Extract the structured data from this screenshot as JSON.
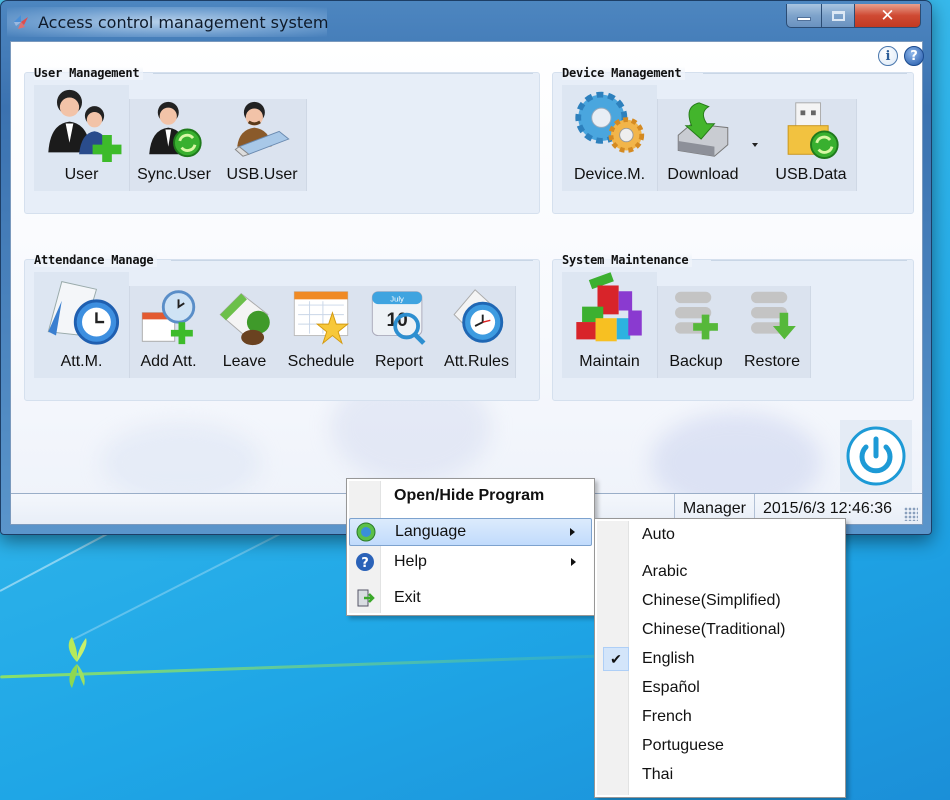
{
  "window": {
    "title": "Access control management system",
    "icon": "app-logo-icon",
    "caption_buttons": [
      "minimize",
      "maximize",
      "close"
    ],
    "close_glyph": "✕"
  },
  "top_icons": [
    {
      "name": "info-icon",
      "glyph": "i"
    },
    {
      "name": "help-icon",
      "glyph": "?"
    }
  ],
  "groups": {
    "user_management": {
      "title": "User Management",
      "primary": {
        "label": "User",
        "icon": "user-add-icon"
      },
      "items": [
        {
          "label": "Sync.User",
          "icon": "sync-user-icon"
        },
        {
          "label": "USB.User",
          "icon": "usb-user-icon"
        }
      ]
    },
    "device_management": {
      "title": "Device Management",
      "primary": {
        "label": "Device.M.",
        "icon": "gears-icon"
      },
      "items": [
        {
          "label": "Download",
          "icon": "download-disk-icon",
          "has_dropdown": true
        },
        {
          "label": "USB.Data",
          "icon": "usb-data-icon"
        }
      ]
    },
    "attendance_manage": {
      "title": "Attendance Manage",
      "primary": {
        "label": "Att.M.",
        "icon": "calendar-clock-icon"
      },
      "items": [
        {
          "label": "Add Att.",
          "icon": "add-attendance-icon"
        },
        {
          "label": "Leave",
          "icon": "leave-icon"
        },
        {
          "label": "Schedule",
          "icon": "schedule-icon"
        },
        {
          "label": "Report",
          "icon": "report-icon",
          "icon_text_month": "July",
          "icon_text_day": "10"
        },
        {
          "label": "Att.Rules",
          "icon": "alarm-clock-icon"
        }
      ]
    },
    "system_maintenance": {
      "title": "System Maintenance",
      "primary": {
        "label": "Maintain",
        "icon": "blocks-icon"
      },
      "items": [
        {
          "label": "Backup",
          "icon": "backup-icon"
        },
        {
          "label": "Restore",
          "icon": "restore-icon"
        }
      ]
    }
  },
  "power_button": {
    "icon": "power-icon"
  },
  "statusbar": {
    "user": "Manager",
    "datetime": "2015/6/3 12:46:36"
  },
  "context_menu": {
    "items": [
      {
        "label": "Open/Hide Program",
        "bold": true
      },
      {
        "label": "Language",
        "icon": "globe-icon",
        "has_submenu": true,
        "highlighted": true
      },
      {
        "label": "Help",
        "icon": "help-icon",
        "has_submenu": true
      },
      {
        "label": "Exit",
        "icon": "exit-door-icon"
      }
    ]
  },
  "language_submenu": {
    "auto": "Auto",
    "languages": [
      "Arabic",
      "Chinese(Simplified)",
      "Chinese(Traditional)",
      "English",
      "Español",
      "French",
      "Portuguese",
      "Thai"
    ],
    "selected": "English",
    "check_glyph": "✔"
  },
  "colors": {
    "desktop": "#2fb4ea",
    "window_frame": "#4d86c0",
    "group_bg": "#e7eef8",
    "menu_highlight": "#c8defb",
    "power_blue": "#1d9ad6"
  }
}
